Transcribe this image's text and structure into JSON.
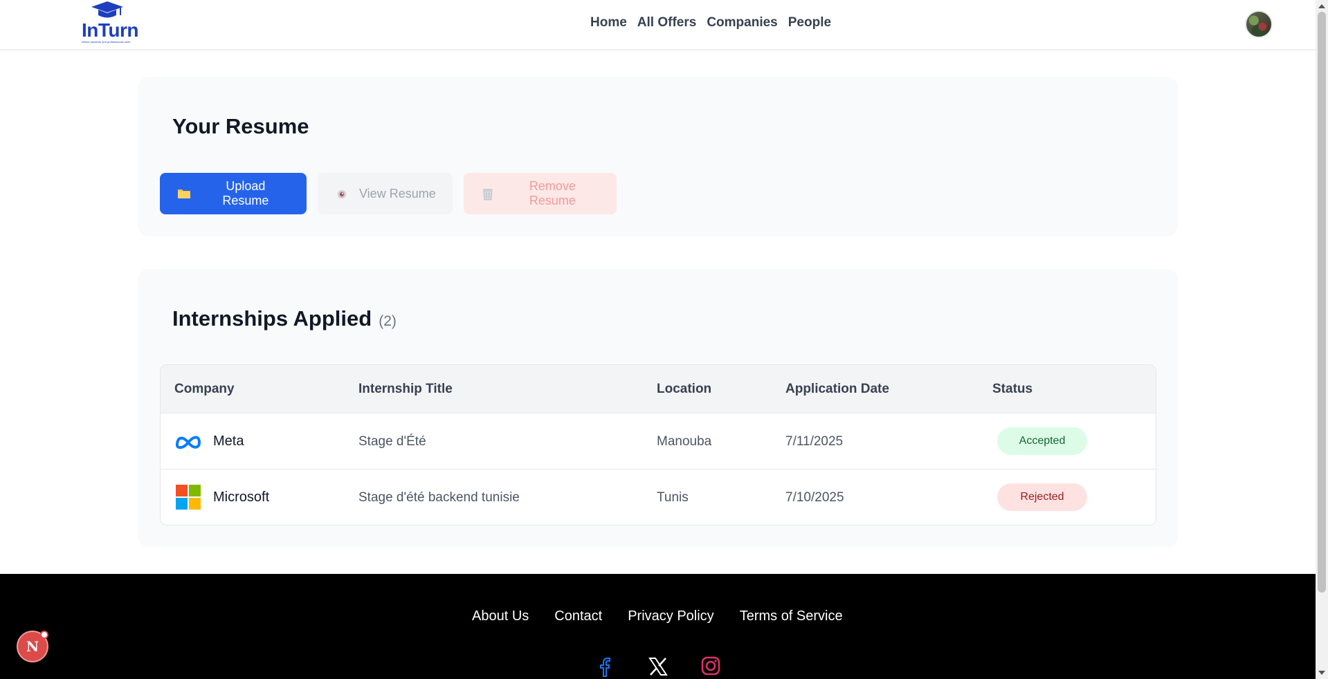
{
  "brand": {
    "name": "InTurn",
    "tagline": "Where students and professionals meet"
  },
  "nav": {
    "items": [
      {
        "label": "Home"
      },
      {
        "label": "All Offers"
      },
      {
        "label": "Companies"
      },
      {
        "label": "People"
      }
    ]
  },
  "resume": {
    "title": "Your Resume",
    "upload_label": "Upload Resume",
    "view_label": "View Resume",
    "remove_label": "Remove Resume"
  },
  "applied": {
    "title": "Internships Applied",
    "count": "(2)",
    "columns": [
      "Company",
      "Internship Title",
      "Location",
      "Application Date",
      "Status"
    ],
    "rows": [
      {
        "company": "Meta",
        "title": "Stage d'Été",
        "location": "Manouba",
        "date": "7/11/2025",
        "status": "Accepted"
      },
      {
        "company": "Microsoft",
        "title": "Stage d'été backend tunisie",
        "location": "Tunis",
        "date": "7/10/2025",
        "status": "Rejected"
      }
    ]
  },
  "footer": {
    "links": [
      {
        "label": "About Us"
      },
      {
        "label": "Contact"
      },
      {
        "label": "Privacy Policy"
      },
      {
        "label": "Terms of Service"
      }
    ],
    "social": [
      "facebook-icon",
      "x-icon",
      "instagram-icon"
    ]
  },
  "dev_indicator": {
    "letter": "N"
  },
  "colors": {
    "primary": "#2563eb",
    "brand": "#1d3fbf",
    "accepted_bg": "#dcfce7",
    "rejected_bg": "#fee2e2",
    "footer_bg": "#000000"
  }
}
